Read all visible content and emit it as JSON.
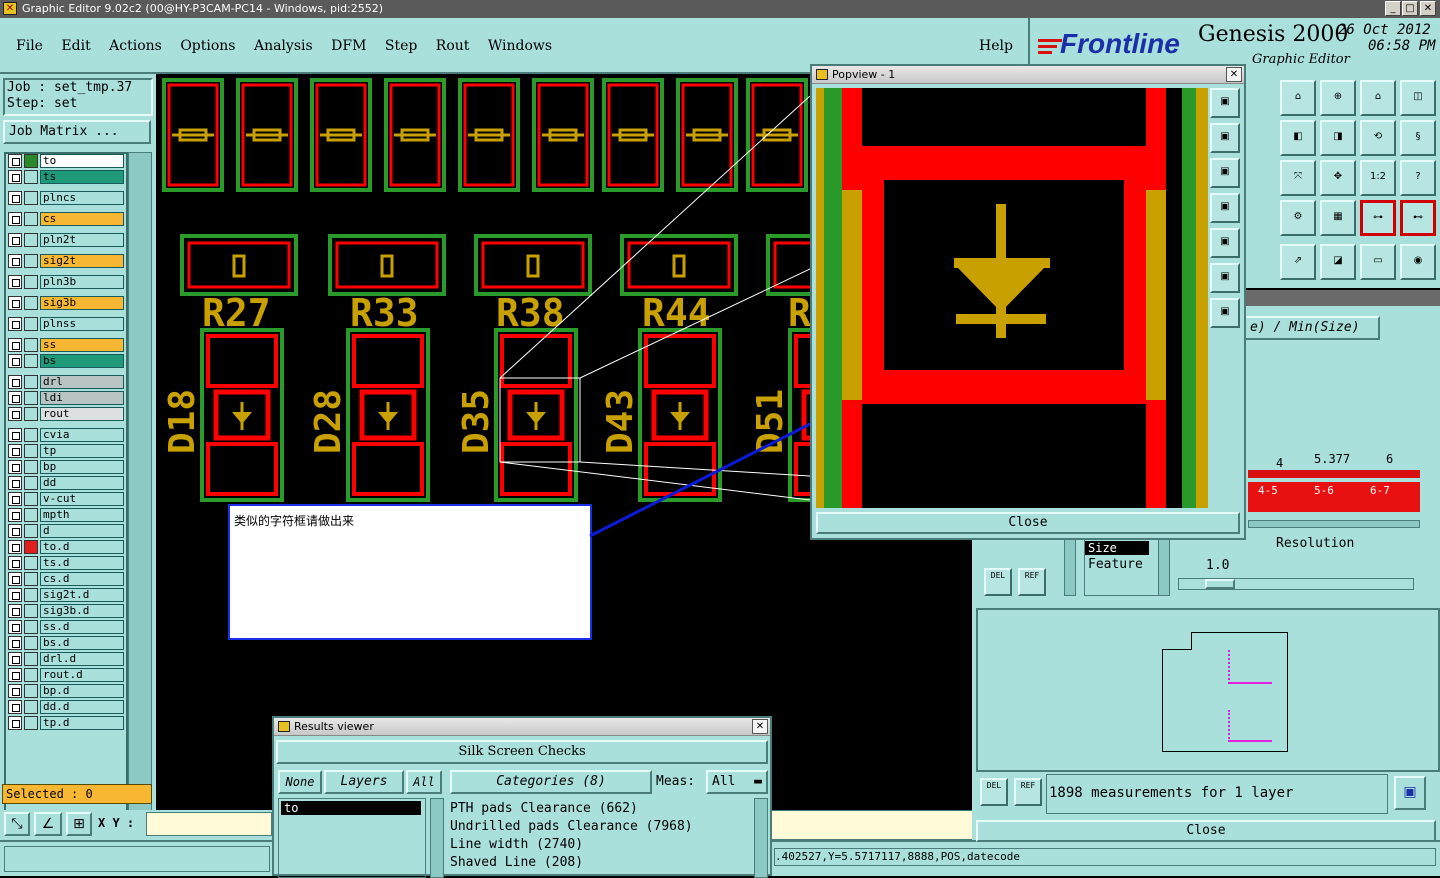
{
  "titlebar": "Graphic Editor 9.02c2 (00@HY-P3CAM-PC14 - Windows, pid:2552)",
  "menu": [
    "File",
    "Edit",
    "Actions",
    "Options",
    "Analysis",
    "DFM",
    "Step",
    "Rout",
    "Windows"
  ],
  "help": "Help",
  "brand": {
    "logo": "Frontline",
    "product": "Genesis 2000",
    "date": "26 Oct 2012",
    "time": "06:58 PM",
    "subtitle": "Graphic Editor"
  },
  "job": {
    "job_line": "Job : set_tmp.37",
    "step_line": "Step: set",
    "matrix_button": "Job Matrix ..."
  },
  "layers": [
    {
      "name": "to",
      "color": "#ffffff",
      "mark": "#2a8a2a"
    },
    {
      "name": "ts",
      "color": "#1e9a7a",
      "mark": ""
    },
    {
      "name": "plncs",
      "color": "#a9e0dc",
      "mark": ""
    },
    {
      "name": "cs",
      "color": "#f7b733",
      "mark": ""
    },
    {
      "name": "pln2t",
      "color": "#a9e0dc",
      "mark": ""
    },
    {
      "name": "sig2t",
      "color": "#f7b733",
      "mark": ""
    },
    {
      "name": "pln3b",
      "color": "#a9e0dc",
      "mark": ""
    },
    {
      "name": "sig3b",
      "color": "#f7b733",
      "mark": ""
    },
    {
      "name": "plnss",
      "color": "#a9e0dc",
      "mark": ""
    },
    {
      "name": "ss",
      "color": "#f7b733",
      "mark": ""
    },
    {
      "name": "bs",
      "color": "#1e9a7a",
      "mark": ""
    },
    {
      "name": "drl",
      "color": "#b8c4c4",
      "mark": ""
    },
    {
      "name": "ldi",
      "color": "#b8c4c4",
      "mark": ""
    },
    {
      "name": "rout",
      "color": "#dde0e0",
      "mark": ""
    },
    {
      "name": "cvia",
      "color": "#a9e0dc",
      "mark": ""
    },
    {
      "name": "tp",
      "color": "#a9e0dc",
      "mark": ""
    },
    {
      "name": "bp",
      "color": "#a9e0dc",
      "mark": ""
    },
    {
      "name": "dd",
      "color": "#a9e0dc",
      "mark": ""
    },
    {
      "name": "v-cut",
      "color": "#a9e0dc",
      "mark": ""
    },
    {
      "name": "mpth",
      "color": "#a9e0dc",
      "mark": ""
    },
    {
      "name": "d",
      "color": "#a9e0dc",
      "mark": ""
    },
    {
      "name": "to.d",
      "color": "#a9e0dc",
      "mark": "#e02020"
    },
    {
      "name": "ts.d",
      "color": "#a9e0dc",
      "mark": ""
    },
    {
      "name": "cs.d",
      "color": "#a9e0dc",
      "mark": ""
    },
    {
      "name": "sig2t.d",
      "color": "#a9e0dc",
      "mark": ""
    },
    {
      "name": "sig3b.d",
      "color": "#a9e0dc",
      "mark": ""
    },
    {
      "name": "ss.d",
      "color": "#a9e0dc",
      "mark": ""
    },
    {
      "name": "bs.d",
      "color": "#a9e0dc",
      "mark": ""
    },
    {
      "name": "drl.d",
      "color": "#a9e0dc",
      "mark": ""
    },
    {
      "name": "rout.d",
      "color": "#a9e0dc",
      "mark": ""
    },
    {
      "name": "bp.d",
      "color": "#a9e0dc",
      "mark": ""
    },
    {
      "name": "dd.d",
      "color": "#a9e0dc",
      "mark": ""
    },
    {
      "name": "tp.d",
      "color": "#a9e0dc",
      "mark": ""
    }
  ],
  "selected": "Selected : 0",
  "xy_label": "X Y :",
  "status_coords": ".402527,Y=5.5717117,8888,POS,datecode",
  "pcb": {
    "resistors": [
      "R27",
      "R33",
      "R38",
      "R44",
      "R"
    ],
    "diodes": [
      "D18",
      "D28",
      "D35",
      "D43",
      "D51"
    ]
  },
  "annotation": "类似的字符框请做出来",
  "popview": {
    "title": "Popview - 1",
    "close": "Close"
  },
  "results": {
    "title": "Results viewer",
    "header": "Silk Screen Checks",
    "none": "None",
    "layers": "Layers",
    "all": "All",
    "categories": "Categories (8)",
    "meas_label": "Meas:",
    "meas_value": "All",
    "layer_item": "to",
    "checks": [
      "PTH pads Clearance (662)",
      "Undrilled pads Clearance (7968)",
      "Line width (2740)",
      "Shaved Line (208)"
    ]
  },
  "analysis": {
    "size_header": "e) / Min(Size)",
    "hist_top": [
      "4",
      "5.377",
      "6"
    ],
    "hist_bins": [
      "4-5",
      "5-6",
      "6-7"
    ],
    "size_label": "Size",
    "feature_label": "Feature",
    "resolution_label": "Resolution",
    "resolution_value": "1.0",
    "del": "DEL",
    "ref": "REF",
    "measurements": "1898 measurements for 1 layer",
    "close": "Close"
  },
  "colors": {
    "teal": "#a9e0dc",
    "pad_red": "#ff0000",
    "silk": "#c8a000",
    "mask_green": "#2a9a2a",
    "arrow": "#0a1ad8"
  }
}
